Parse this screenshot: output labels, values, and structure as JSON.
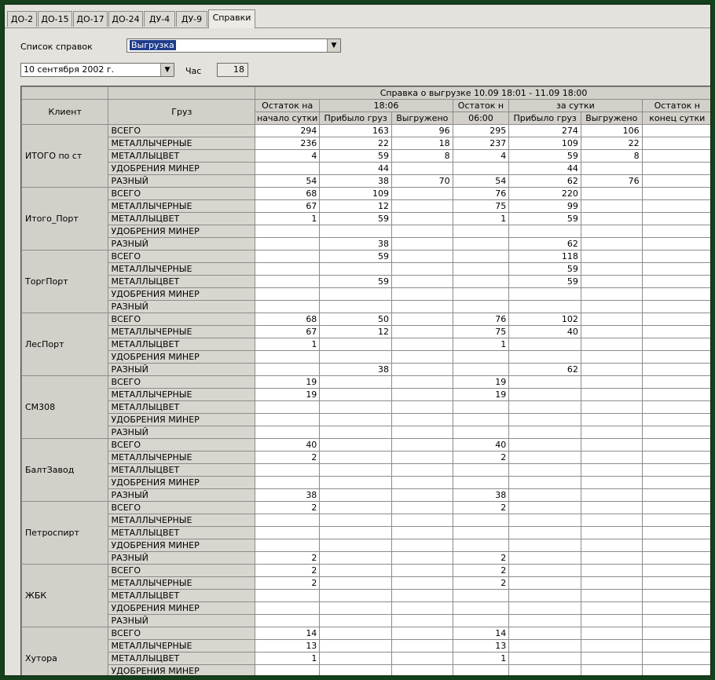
{
  "tabs": [
    {
      "label": "ДО-2"
    },
    {
      "label": "ДО-15"
    },
    {
      "label": "ДО-17"
    },
    {
      "label": "ДО-24"
    },
    {
      "label": "ДУ-4"
    },
    {
      "label": "ДУ-9"
    },
    {
      "label": "Справки",
      "active": true
    }
  ],
  "controls": {
    "list_label": "Список справок",
    "list_value": "Выгрузка",
    "date_value": "10 сентября 2002 г.",
    "hour_label": "Час",
    "hour_value": "18"
  },
  "table": {
    "col_client": "Клиент",
    "col_cargo": "Груз",
    "report_title": "Справка о выгрузке 10.09 18:01 - 11.09 18:00",
    "group_1806": "18:06",
    "group_day": "за сутки",
    "col_headers_top": [
      "Остаток на",
      "",
      "",
      "Остаток н",
      "",
      "",
      "Остаток н"
    ],
    "col_headers_bottom": [
      "начало сутки",
      "Прибыло груз",
      "Выгружено",
      "06:00",
      "Прибыло груз",
      "Выгружено",
      "конец сутки"
    ],
    "cargo_types": [
      "ВСЕГО",
      "МЕТАЛЛЫЧЕРНЫЕ",
      "МЕТАЛЛЫЦВЕТ",
      "УДОБРЕНИЯ МИНЕР",
      "РАЗНЫЙ"
    ],
    "clients": [
      {
        "name": "ИТОГО по ст",
        "rows": [
          [
            "294",
            "163",
            "96",
            "295",
            "274",
            "106",
            ""
          ],
          [
            "236",
            "22",
            "18",
            "237",
            "109",
            "22",
            ""
          ],
          [
            "4",
            "59",
            "8",
            "4",
            "59",
            "8",
            ""
          ],
          [
            "",
            "44",
            "",
            "",
            "44",
            "",
            ""
          ],
          [
            "54",
            "38",
            "70",
            "54",
            "62",
            "76",
            ""
          ]
        ]
      },
      {
        "name": "Итого_Порт",
        "rows": [
          [
            "68",
            "109",
            "",
            "76",
            "220",
            "",
            ""
          ],
          [
            "67",
            "12",
            "",
            "75",
            "99",
            "",
            ""
          ],
          [
            "1",
            "59",
            "",
            "1",
            "59",
            "",
            ""
          ],
          [
            "",
            "",
            "",
            "",
            "",
            "",
            ""
          ],
          [
            "",
            "38",
            "",
            "",
            "62",
            "",
            ""
          ]
        ]
      },
      {
        "name": "ТоргПорт",
        "rows": [
          [
            "",
            "59",
            "",
            "",
            "118",
            "",
            ""
          ],
          [
            "",
            "",
            "",
            "",
            "59",
            "",
            ""
          ],
          [
            "",
            "59",
            "",
            "",
            "59",
            "",
            ""
          ],
          [
            "",
            "",
            "",
            "",
            "",
            "",
            ""
          ],
          [
            "",
            "",
            "",
            "",
            "",
            "",
            ""
          ]
        ]
      },
      {
        "name": "ЛесПорт",
        "rows": [
          [
            "68",
            "50",
            "",
            "76",
            "102",
            "",
            ""
          ],
          [
            "67",
            "12",
            "",
            "75",
            "40",
            "",
            ""
          ],
          [
            "1",
            "",
            "",
            "1",
            "",
            "",
            ""
          ],
          [
            "",
            "",
            "",
            "",
            "",
            "",
            ""
          ],
          [
            "",
            "38",
            "",
            "",
            "62",
            "",
            ""
          ]
        ]
      },
      {
        "name": "СМ308",
        "rows": [
          [
            "19",
            "",
            "",
            "19",
            "",
            "",
            ""
          ],
          [
            "19",
            "",
            "",
            "19",
            "",
            "",
            ""
          ],
          [
            "",
            "",
            "",
            "",
            "",
            "",
            ""
          ],
          [
            "",
            "",
            "",
            "",
            "",
            "",
            ""
          ],
          [
            "",
            "",
            "",
            "",
            "",
            "",
            ""
          ]
        ]
      },
      {
        "name": "БалтЗавод",
        "rows": [
          [
            "40",
            "",
            "",
            "40",
            "",
            "",
            ""
          ],
          [
            "2",
            "",
            "",
            "2",
            "",
            "",
            ""
          ],
          [
            "",
            "",
            "",
            "",
            "",
            "",
            ""
          ],
          [
            "",
            "",
            "",
            "",
            "",
            "",
            ""
          ],
          [
            "38",
            "",
            "",
            "38",
            "",
            "",
            ""
          ]
        ]
      },
      {
        "name": "Петроспирт",
        "rows": [
          [
            "2",
            "",
            "",
            "2",
            "",
            "",
            ""
          ],
          [
            "",
            "",
            "",
            "",
            "",
            "",
            ""
          ],
          [
            "",
            "",
            "",
            "",
            "",
            "",
            ""
          ],
          [
            "",
            "",
            "",
            "",
            "",
            "",
            ""
          ],
          [
            "2",
            "",
            "",
            "2",
            "",
            "",
            ""
          ]
        ]
      },
      {
        "name": "ЖБК",
        "rows": [
          [
            "2",
            "",
            "",
            "2",
            "",
            "",
            ""
          ],
          [
            "2",
            "",
            "",
            "2",
            "",
            "",
            ""
          ],
          [
            "",
            "",
            "",
            "",
            "",
            "",
            ""
          ],
          [
            "",
            "",
            "",
            "",
            "",
            "",
            ""
          ],
          [
            "",
            "",
            "",
            "",
            "",
            "",
            ""
          ]
        ]
      },
      {
        "name": "Хутора",
        "rows": [
          [
            "14",
            "",
            "",
            "14",
            "",
            "",
            ""
          ],
          [
            "13",
            "",
            "",
            "13",
            "",
            "",
            ""
          ],
          [
            "1",
            "",
            "",
            "1",
            "",
            "",
            ""
          ],
          [
            "",
            "",
            "",
            "",
            "",
            "",
            ""
          ],
          [
            "",
            "",
            "",
            "",
            "",
            "",
            ""
          ]
        ]
      }
    ]
  }
}
